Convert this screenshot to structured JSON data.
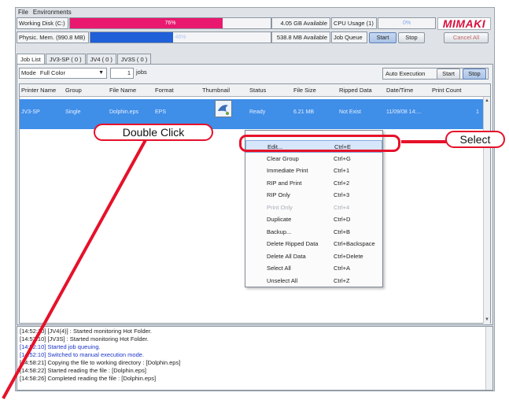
{
  "menu": [
    "File",
    "Environments"
  ],
  "status": {
    "working_disk_label": "Working Disk (C:)",
    "working_disk_pct": "76%",
    "working_disk_available": "4.05 GB Available",
    "phys_mem_label": "Physic. Mem. (990.8 MB)",
    "phys_mem_pct": "46%",
    "phys_mem_available": "538.8 MB Available",
    "cpu_label": "CPU Usage (1)",
    "cpu_pct": "0%",
    "job_queue_label": "Job Queue",
    "start": "Start",
    "stop": "Stop",
    "cancel_all": "Cancel All",
    "logo": "MIMAKI"
  },
  "tabs": [
    "Job List",
    "JV3-SP ( 0 )",
    "JV4 ( 0 )",
    "JV3S ( 0 )"
  ],
  "mode": {
    "label": "Mode",
    "value": "Full Color",
    "count": "1",
    "unit": "jobs"
  },
  "auto": {
    "label": "Auto Execution",
    "start": "Start",
    "stop": "Stop"
  },
  "columns": [
    "Printer Name",
    "Group",
    "File Name",
    "Format",
    "Thumbnail",
    "Status",
    "File Size",
    "Ripped Data",
    "Date/Time",
    "Print Count"
  ],
  "row": {
    "printer": "JV3-SP",
    "group": "Single",
    "file": "Dolphin.eps",
    "format": "EPS",
    "status": "Ready",
    "size": "6.21 MB",
    "ripped": "Not Exist",
    "datetime": "11/09/08 14:...",
    "count": "1"
  },
  "context_menu": [
    {
      "label": "Edit...",
      "shortcut": "Ctrl+E",
      "state": "highlight"
    },
    {
      "label": "Clear Group",
      "shortcut": "Ctrl+G",
      "state": "normal"
    },
    {
      "label": "Immediate Print",
      "shortcut": "Ctrl+1",
      "state": "normal"
    },
    {
      "label": "RIP and Print",
      "shortcut": "Ctrl+2",
      "state": "normal"
    },
    {
      "label": "RIP Only",
      "shortcut": "Ctrl+3",
      "state": "normal"
    },
    {
      "label": "Print Only",
      "shortcut": "Ctrl+4",
      "state": "disabled"
    },
    {
      "label": "Duplicate",
      "shortcut": "Ctrl+D",
      "state": "normal"
    },
    {
      "label": "Backup...",
      "shortcut": "Ctrl+B",
      "state": "normal"
    },
    {
      "label": "Delete Ripped Data",
      "shortcut": "Ctrl+Backspace",
      "state": "normal"
    },
    {
      "label": "Delete All Data",
      "shortcut": "Ctrl+Delete",
      "state": "normal"
    },
    {
      "label": "Select All",
      "shortcut": "Ctrl+A",
      "state": "normal"
    },
    {
      "label": "Unselect All",
      "shortcut": "Ctrl+Z",
      "state": "normal"
    }
  ],
  "log": [
    {
      "text": "[14:52:10] [JV4(4)] : Started monitoring Hot Folder.",
      "color": "black"
    },
    {
      "text": "[14:52:10] [JV3S] : Started monitoring Hot Folder.",
      "color": "black"
    },
    {
      "text": "[14:52:10] Started job queuing.",
      "color": "blue"
    },
    {
      "text": "[14:52:10] Switched to manual execution mode.",
      "color": "blue"
    },
    {
      "text": "[14:58:21] Copying the file to working directory : [Dolphin.eps]",
      "color": "black"
    },
    {
      "text": "[14:58:22] Started reading the file : [Dolphin.eps]",
      "color": "black"
    },
    {
      "text": "[14:58:26] Completed reading the file : [Dolphin.eps]",
      "color": "black"
    }
  ],
  "annotations": {
    "double_click": "Double Click",
    "select": "Select"
  },
  "colors": {
    "disk_bar": "#e8196f",
    "mem_bar": "#1f5fd8",
    "accent_red": "#e6112a",
    "row_select": "#3f8ee8"
  }
}
